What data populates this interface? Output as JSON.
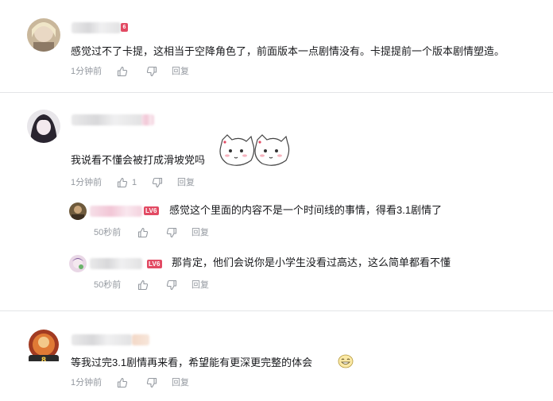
{
  "comments": [
    {
      "text": "感觉过不了卡提，这相当于空降角色了，前面版本一点剧情没有。卡提提前一个版本剧情塑造。",
      "time": "1分钟前",
      "like_count": "",
      "reply_label": "回复"
    },
    {
      "text": "我说看不懂会被打成滑坡党吗",
      "time": "1分钟前",
      "like_count": "1",
      "reply_label": "回复",
      "replies": [
        {
          "level": "LV6",
          "text": "感觉这个里面的内容不是一个时间线的事情，得看3.1剧情了",
          "time": "50秒前",
          "reply_label": "回复"
        },
        {
          "level": "LV6",
          "text": "那肯定，他们会说你是小学生没看过高达，这么简单都看不懂",
          "time": "50秒前",
          "reply_label": "回复"
        }
      ]
    },
    {
      "text": "等我过完3.1剧情再来看，希望能有更深更完整的体会",
      "time": "1分钟前",
      "like_count": "",
      "reply_label": "回复"
    }
  ],
  "colors": {
    "meta": "#9499a0",
    "level_badge": "#e24a63",
    "divider": "#e3e5e7"
  }
}
